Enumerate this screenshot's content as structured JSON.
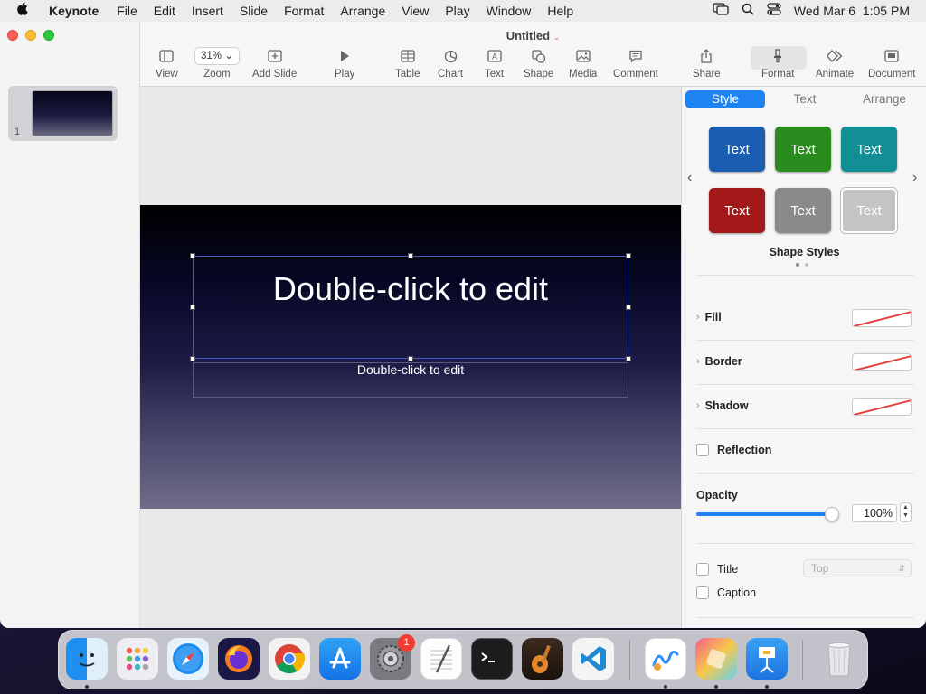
{
  "menubar": {
    "app": "Keynote",
    "items": [
      "File",
      "Edit",
      "Insert",
      "Slide",
      "Format",
      "Arrange",
      "View",
      "Play",
      "Window",
      "Help"
    ],
    "clock": "Wed Mar 6  1:05 PM"
  },
  "document": {
    "title": "Untitled"
  },
  "toolbar": {
    "view": "View",
    "zoom_value": "31%",
    "zoom": "Zoom",
    "add_slide": "Add Slide",
    "play": "Play",
    "table": "Table",
    "chart": "Chart",
    "text": "Text",
    "shape": "Shape",
    "media": "Media",
    "comment": "Comment",
    "share": "Share",
    "format": "Format",
    "animate": "Animate",
    "document": "Document"
  },
  "navigator": {
    "slide_number": "1"
  },
  "slide": {
    "title": "Double-click to edit",
    "subtitle": "Double-click to edit"
  },
  "panel": {
    "tabs": [
      "Style",
      "Text",
      "Arrange"
    ],
    "style_buttons": [
      {
        "label": "Text",
        "color": "#1a5db0"
      },
      {
        "label": "Text",
        "color": "#2a8c1e"
      },
      {
        "label": "Text",
        "color": "#128e95"
      },
      {
        "label": "Text",
        "color": "#a3191a"
      },
      {
        "label": "Text",
        "color": "#8a8a8a"
      },
      {
        "label": "Text",
        "color": "#c4c4c4"
      }
    ],
    "shape_styles_title": "Shape Styles",
    "fill": "Fill",
    "border": "Border",
    "shadow": "Shadow",
    "reflection": "Reflection",
    "opacity": "Opacity",
    "opacity_value": "100%",
    "opacity_level": 1.0,
    "title_check": "Title",
    "caption_check": "Caption",
    "title_position": "Top"
  },
  "dock": {
    "badge_count": "1"
  }
}
